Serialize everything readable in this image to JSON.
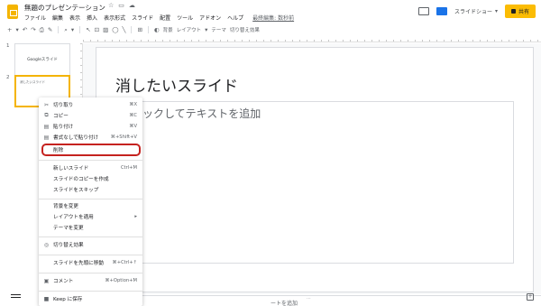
{
  "app": {
    "title": "無題のプレゼンテーション",
    "menu": [
      "ファイル",
      "編集",
      "表示",
      "挿入",
      "表示形式",
      "スライド",
      "配置",
      "ツール",
      "アドオン",
      "ヘルプ"
    ],
    "last_edit": "最終編集: 数秒前",
    "slideshow_label": "スライドショー",
    "share_label": "共有"
  },
  "toolbar": {
    "background_label": "背景",
    "layout_label": "レイアウト",
    "theme_label": "テーマ",
    "transition_label": "切り替え効果"
  },
  "filmstrip": {
    "slides": [
      {
        "number": "1",
        "thumb_text": "Googleスライド"
      },
      {
        "number": "2",
        "thumb_text": "消したいスライド"
      }
    ]
  },
  "slide": {
    "title": "消したいスライド",
    "body_placeholder": "ックしてテキストを追加"
  },
  "notes": {
    "placeholder": "ートを追加"
  },
  "context_menu": {
    "items": [
      {
        "icon": "scissors-icon",
        "glyph": "✂",
        "label": "切り取り",
        "shortcut": "⌘X"
      },
      {
        "icon": "copy-icon",
        "glyph": "⧉",
        "label": "コピー",
        "shortcut": "⌘C"
      },
      {
        "icon": "paste-icon",
        "glyph": "▤",
        "label": "貼り付け",
        "shortcut": "⌘V"
      },
      {
        "icon": "paste-plain-icon",
        "glyph": "▤",
        "label": "書式なしで貼り付け",
        "shortcut": "⌘+Shift+V"
      },
      {
        "icon": "",
        "glyph": "",
        "label": "削除",
        "shortcut": ""
      },
      {
        "icon": "",
        "glyph": "",
        "label": "新しいスライド",
        "shortcut": "Ctrl+M"
      },
      {
        "icon": "",
        "glyph": "",
        "label": "スライドのコピーを作成",
        "shortcut": ""
      },
      {
        "icon": "",
        "glyph": "",
        "label": "スライドをスキップ",
        "shortcut": ""
      },
      {
        "icon": "",
        "glyph": "",
        "label": "背景を変更",
        "shortcut": ""
      },
      {
        "icon": "",
        "glyph": "",
        "label": "レイアウトを適用",
        "shortcut": "▸"
      },
      {
        "icon": "",
        "glyph": "",
        "label": "テーマを変更",
        "shortcut": ""
      },
      {
        "icon": "transition-icon",
        "glyph": "◎",
        "label": "切り替え効果",
        "shortcut": ""
      },
      {
        "icon": "",
        "glyph": "",
        "label": "スライドを先頭に移動",
        "shortcut": "⌘+Ctrl+↑"
      },
      {
        "icon": "comment-icon",
        "glyph": "▣",
        "label": "コメント",
        "shortcut": "⌘+Option+M"
      },
      {
        "icon": "keep-icon",
        "glyph": "■",
        "label": "Keep に保存",
        "shortcut": ""
      }
    ]
  },
  "colors": {
    "accent_yellow": "#f4b400",
    "share_button": "#fbbc04",
    "highlight_red": "#c5221f"
  }
}
